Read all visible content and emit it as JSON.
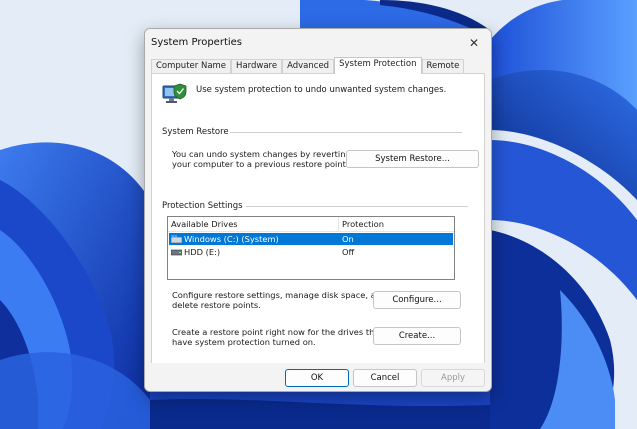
{
  "dialog": {
    "title": "System Properties",
    "close_glyph": "✕",
    "tabs": [
      {
        "label": "Computer Name",
        "active": false
      },
      {
        "label": "Hardware",
        "active": false
      },
      {
        "label": "Advanced",
        "active": false
      },
      {
        "label": "System Protection",
        "active": true
      },
      {
        "label": "Remote",
        "active": false
      }
    ],
    "header_text": "Use system protection to undo unwanted system changes.",
    "header_icon": "system-protection-icon",
    "system_restore": {
      "label": "System Restore",
      "description_line1": "You can undo system changes by reverting",
      "description_line2": "your computer to a previous restore point.",
      "button": "System Restore..."
    },
    "protection_settings": {
      "label": "Protection Settings",
      "columns": [
        "Available Drives",
        "Protection"
      ],
      "drives": [
        {
          "name": "Windows (C:) (System)",
          "protection": "On",
          "selected": true,
          "icon": "windows-drive-icon"
        },
        {
          "name": "HDD (E:)",
          "protection": "Off",
          "selected": false,
          "icon": "hard-drive-icon"
        }
      ],
      "configure_text_line1": "Configure restore settings, manage disk space, and",
      "configure_text_line2": "delete restore points.",
      "configure_button": "Configure...",
      "create_text_line1": "Create a restore point right now for the drives that",
      "create_text_line2": "have system protection turned on.",
      "create_button": "Create..."
    },
    "footer": {
      "ok": "OK",
      "cancel": "Cancel",
      "apply": "Apply"
    }
  },
  "colors": {
    "accent": "#0078d7",
    "wallpaper_dark": "#0a2fb0",
    "wallpaper_light": "#dfe9f6"
  }
}
